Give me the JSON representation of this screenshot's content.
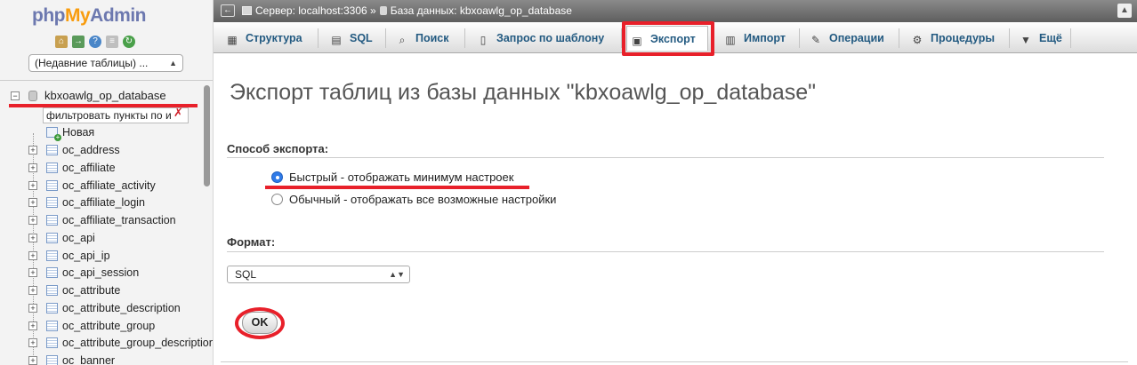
{
  "logo": {
    "php": "php",
    "my": "My",
    "admin": "Admin"
  },
  "nav": {
    "icons": [
      "home-icon",
      "exit-icon",
      "help-icon",
      "docs-icon",
      "reload-icon"
    ],
    "recent_tables": "(Недавние таблицы) ...",
    "database": "kbxoawlg_op_database",
    "filter_placeholder": "фильтровать пункты по и",
    "new_label": "Новая",
    "tables": [
      "oc_address",
      "oc_affiliate",
      "oc_affiliate_activity",
      "oc_affiliate_login",
      "oc_affiliate_transaction",
      "oc_api",
      "oc_api_ip",
      "oc_api_session",
      "oc_attribute",
      "oc_attribute_description",
      "oc_attribute_group",
      "oc_attribute_group_description",
      "oc_banner"
    ]
  },
  "topbar": {
    "server": "Сервер: localhost:3306",
    "separator": "»",
    "database": "База данных: kbxoawlg_op_database"
  },
  "tabs": [
    {
      "label": "Структура",
      "icon": "structure-icon"
    },
    {
      "label": "SQL",
      "icon": "sql-icon"
    },
    {
      "label": "Поиск",
      "icon": "search-icon"
    },
    {
      "label": "Запрос по шаблону",
      "icon": "query-icon"
    },
    {
      "label": "Экспорт",
      "icon": "export-icon",
      "active": true
    },
    {
      "label": "Импорт",
      "icon": "import-icon"
    },
    {
      "label": "Операции",
      "icon": "operations-icon"
    },
    {
      "label": "Процедуры",
      "icon": "routines-icon"
    },
    {
      "label": "Ещё",
      "icon": "more-icon"
    }
  ],
  "main": {
    "title": "Экспорт таблиц из базы данных \"kbxoawlg_op_database\"",
    "method_label": "Способ экспорта:",
    "method_options": [
      {
        "label": "Быстрый - отображать минимум настроек",
        "selected": true
      },
      {
        "label": "Обычный - отображать все возможные настройки",
        "selected": false
      }
    ],
    "format_label": "Формат:",
    "format_value": "SQL",
    "ok_label": "OK"
  },
  "colors": {
    "highlight": "#e8202a",
    "tab_text": "#235a81",
    "logo_blue": "#6c78af",
    "logo_orange": "#f89c0e"
  }
}
